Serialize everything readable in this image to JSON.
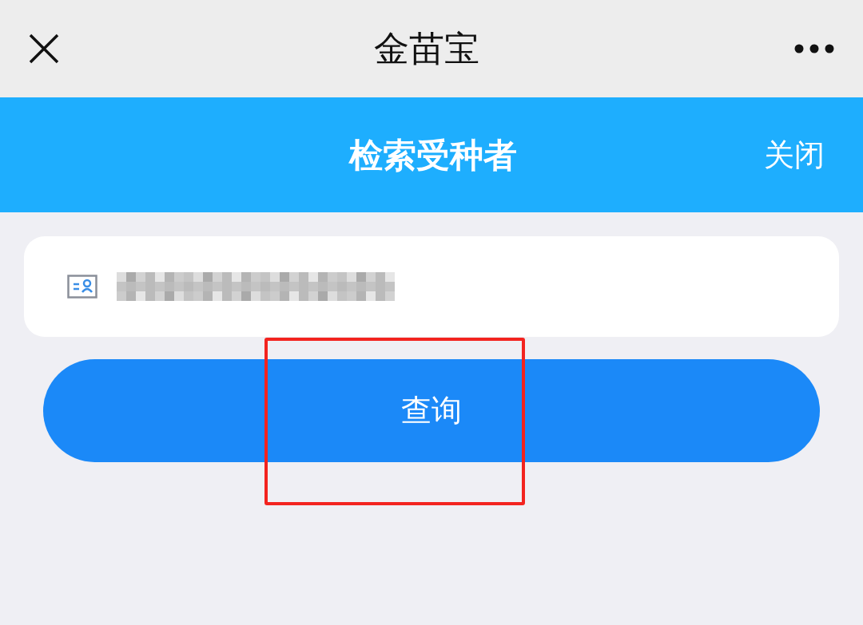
{
  "window": {
    "title": "金苗宝"
  },
  "header": {
    "title": "检索受种者",
    "close_label": "关闭"
  },
  "search_field": {
    "redacted": true
  },
  "query_button": {
    "label": "查询",
    "highlighted": true
  }
}
